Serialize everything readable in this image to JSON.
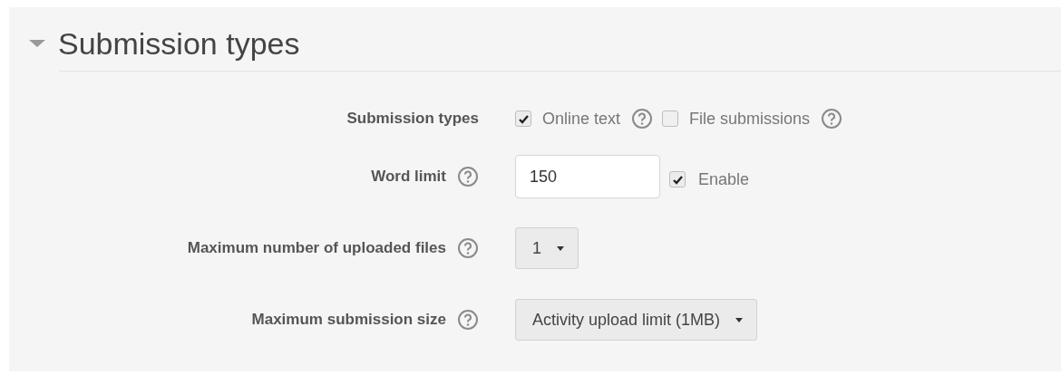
{
  "section": {
    "title": "Submission types",
    "expanded": true
  },
  "fields": [
    {
      "label": "Submission types",
      "help": false,
      "kind": "checkboxes",
      "options": [
        {
          "label": "Online text",
          "checked": true,
          "help": true
        },
        {
          "label": "File submissions",
          "checked": false,
          "help": true
        }
      ]
    },
    {
      "label": "Word limit",
      "help": true,
      "kind": "text",
      "value": "150",
      "enable": {
        "label": "Enable",
        "checked": true
      }
    },
    {
      "label": "Maximum number of uploaded files",
      "help": true,
      "kind": "select",
      "value": "1"
    },
    {
      "label": "Maximum submission size",
      "help": true,
      "kind": "select",
      "value": "Activity upload limit (1MB)"
    }
  ]
}
